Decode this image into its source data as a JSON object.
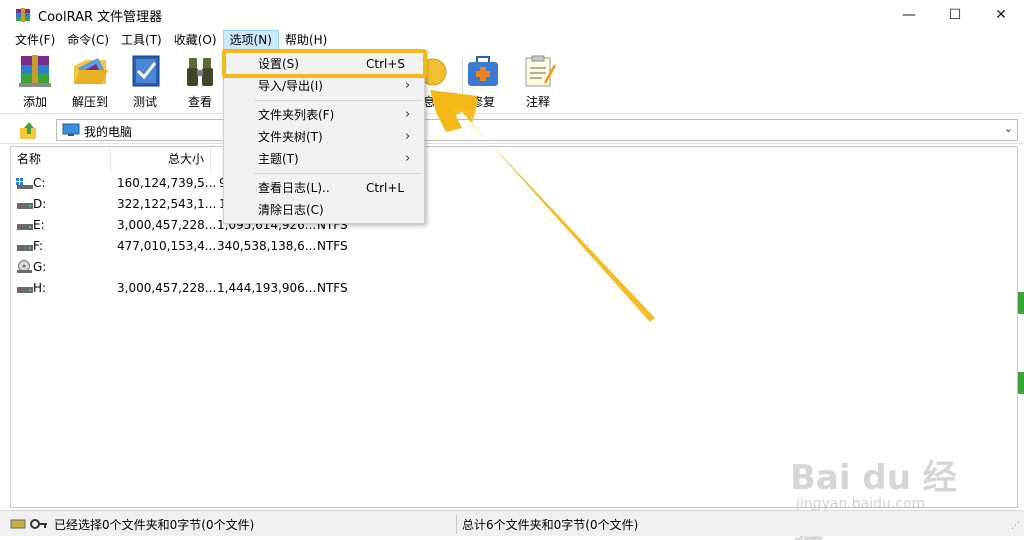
{
  "window": {
    "title": "CoolRAR 文件管理器",
    "minimize": "—",
    "maximize": "☐",
    "close": "✕"
  },
  "menubar": {
    "items": [
      "文件(F)",
      "命令(C)",
      "工具(T)",
      "收藏(O)",
      "选项(N)",
      "帮助(H)"
    ],
    "active": "选项(N)"
  },
  "toolbar": {
    "buttons": [
      {
        "label": "添加",
        "icon": "archive-add-icon"
      },
      {
        "label": "解压到",
        "icon": "extract-folder-icon"
      },
      {
        "label": "测试",
        "icon": "test-check-icon"
      },
      {
        "label": "查看",
        "icon": "binoculars-icon"
      },
      {
        "label": "息",
        "icon": "info-icon"
      },
      {
        "label": "修复",
        "icon": "first-aid-kit-icon"
      },
      {
        "label": "注释",
        "icon": "notepad-icon"
      }
    ]
  },
  "address": {
    "path": "我的电脑",
    "dropdown": "⌄"
  },
  "filelist": {
    "columns": [
      "名称",
      "总大小"
    ],
    "rows": [
      {
        "name": "C:",
        "size": "160,124,739,5...",
        "free": "9",
        "fs": ""
      },
      {
        "name": "D:",
        "size": "322,122,543,1...",
        "free": "1",
        "fs": ""
      },
      {
        "name": "E:",
        "size": "3,000,457,228...",
        "free": "1,095,614,926...",
        "fs": "NTFS"
      },
      {
        "name": "F:",
        "size": "477,010,153,4...",
        "free": "340,538,138,6...",
        "fs": "NTFS"
      },
      {
        "name": "G:",
        "size": "",
        "free": "",
        "fs": ""
      },
      {
        "name": "H:",
        "size": "3,000,457,228...",
        "free": "1,444,193,906...",
        "fs": "NTFS"
      }
    ]
  },
  "options_menu": {
    "items": [
      {
        "label": "设置(S)",
        "shortcut": "Ctrl+S",
        "submenu": false
      },
      {
        "label": "导入/导出(I)",
        "shortcut": "",
        "submenu": true
      },
      {
        "label": "文件夹列表(F)",
        "shortcut": "",
        "submenu": true
      },
      {
        "label": "文件夹树(T)",
        "shortcut": "",
        "submenu": true
      },
      {
        "label": "主题(T)",
        "shortcut": "",
        "submenu": true
      },
      {
        "label": "查看日志(L)..",
        "shortcut": "Ctrl+L",
        "submenu": false
      },
      {
        "label": "清除日志(C)",
        "shortcut": "",
        "submenu": false
      }
    ],
    "submenu_arrow": "›"
  },
  "statusbar": {
    "selected": "已经选择0个文件夹和0字节(0个文件)",
    "total": "总计6个文件夹和0字节(0个文件)"
  },
  "watermark": {
    "brand": "Bai du 经验",
    "url": "jingyan.baidu.com"
  },
  "colors": {
    "highlight": "#f5b819",
    "menu_active": "#cce8ff",
    "menu_bg": "#f2f2f2"
  }
}
